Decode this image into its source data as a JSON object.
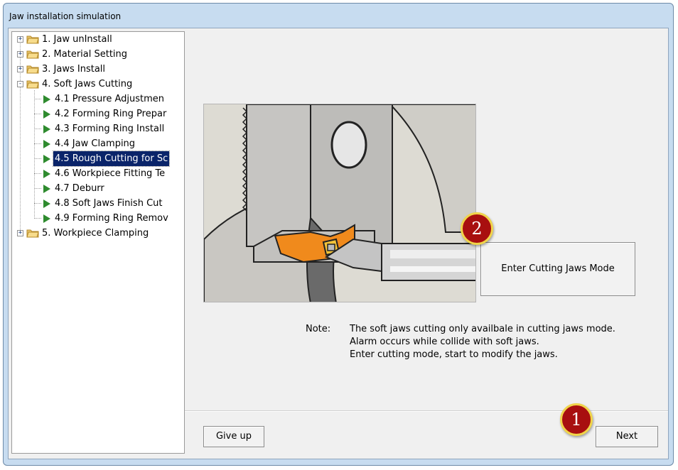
{
  "window": {
    "title": "Jaw installation simulation"
  },
  "tree": {
    "items": [
      {
        "label": "1. Jaw unInstall",
        "expander": "+"
      },
      {
        "label": "2. Material Setting",
        "expander": "+"
      },
      {
        "label": "3. Jaws Install",
        "expander": "+"
      },
      {
        "label": "4. Soft Jaws Cutting",
        "expander": "-"
      },
      {
        "label": "4.1 Pressure Adjustmen"
      },
      {
        "label": "4.2 Forming Ring Prepar"
      },
      {
        "label": "4.3 Forming Ring Install"
      },
      {
        "label": "4.4 Jaw Clamping"
      },
      {
        "label": "4.5 Rough Cutting for Sc",
        "selected": true
      },
      {
        "label": "4.6 Workpiece Fitting Te"
      },
      {
        "label": "4.7 Deburr"
      },
      {
        "label": "4.8 Soft Jaws Finish Cut"
      },
      {
        "label": "4.9 Forming Ring Remov"
      },
      {
        "label": "5. Workpiece Clamping",
        "expander": "+"
      }
    ]
  },
  "main": {
    "cut_button_label": "Enter Cutting Jaws Mode",
    "note_label": "Note:",
    "note_lines": [
      "The soft jaws cutting only availbale in cutting jaws mode.",
      "Alarm occurs while collide with soft jaws.",
      "Enter cutting mode, start to modify the jaws."
    ]
  },
  "buttons": {
    "give_up": "Give up",
    "next": "Next"
  },
  "badges": {
    "one": "1",
    "two": "2"
  },
  "colors": {
    "selection": "#0a246a",
    "badge": "#a80f0f",
    "badge_ring": "#f0d44a",
    "play_icon": "#2e8b2e",
    "tool_orange": "#f08a1c"
  }
}
